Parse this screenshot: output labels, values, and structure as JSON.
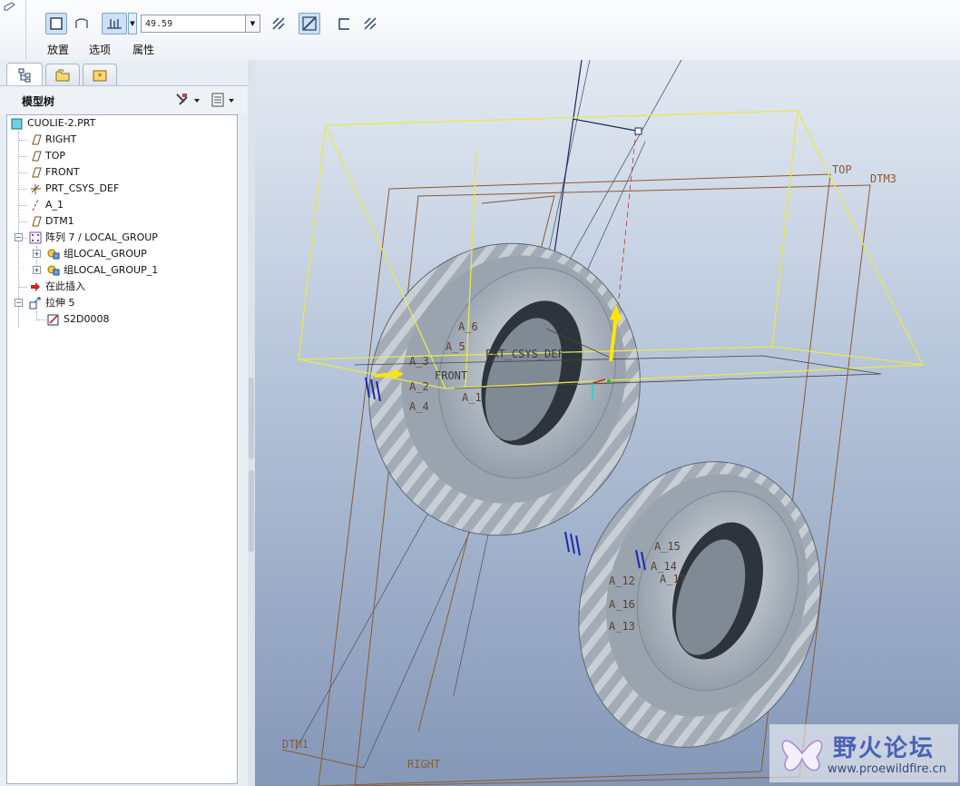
{
  "dashboard": {
    "depth_value": "49.59",
    "tabs": [
      "放置",
      "选项",
      "属性"
    ]
  },
  "panel": {
    "tree_title": "模型树"
  },
  "tree": {
    "nodes": [
      "CUOLIE-2.PRT",
      "RIGHT",
      "TOP",
      "FRONT",
      "PRT_CSYS_DEF",
      "A_1",
      "DTM1",
      "阵列 7 / LOCAL_GROUP",
      "组LOCAL_GROUP",
      "组LOCAL_GROUP_1",
      "在此插入",
      "拉伸 5",
      "S2D0008"
    ]
  },
  "viewport": {
    "datum_labels": [
      "TOP",
      "DTM3",
      "DTM1",
      "RIGHT",
      "PRT_CSYS_DEF",
      "FRONT"
    ],
    "axis_labels": [
      "A_6",
      "A_5",
      "A_3",
      "A_2",
      "A_4",
      "A_1",
      "A_15",
      "A_14",
      "A_12",
      "A_17",
      "A_16",
      "A_13"
    ],
    "watermark_title": "野火论坛",
    "watermark_url": "www.proewildfire.cn"
  },
  "colors": {
    "accent": "#7fa3cf",
    "datum_plane": "#8a5a33",
    "preview_box": "#e8e84a",
    "drag_handle": "#ffe600",
    "model": "#a9b2bc"
  }
}
